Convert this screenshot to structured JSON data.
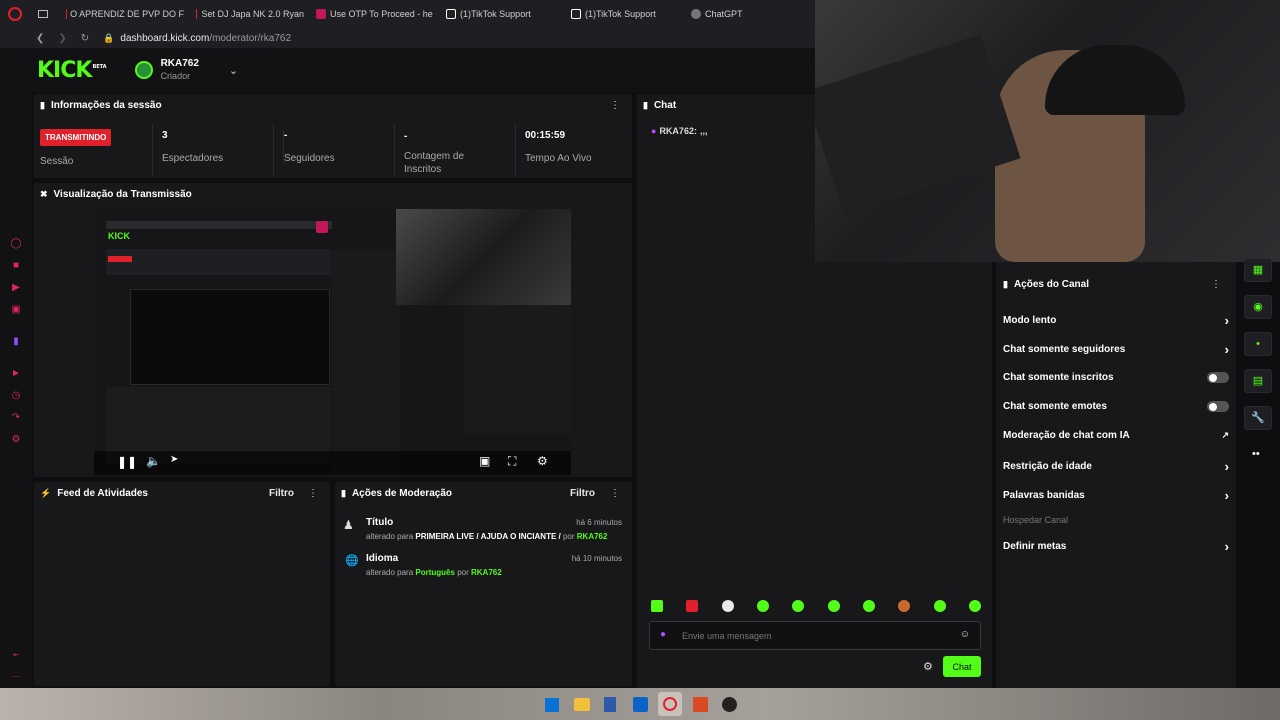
{
  "browser": {
    "tabs": [
      {
        "label": "O APRENDIZ DE PVP DO F",
        "color": "#e0202a"
      },
      {
        "label": "Set DJ Japa NK 2.0 Ryan",
        "color": "#e0202a"
      },
      {
        "label": "Use OTP To Proceed - he",
        "color": "#c2185b"
      },
      {
        "label": "(1)TikTok Support",
        "color": "#ffffff"
      },
      {
        "label": "(1)TikTok Support",
        "color": "#ffffff"
      },
      {
        "label": "ChatGPT",
        "color": "#cccccc"
      }
    ],
    "url_host": "dashboard.kick.com",
    "url_path": "/moderator/rka762"
  },
  "header": {
    "logo": "KICK",
    "logo_tag": "BETA",
    "username": "RKA762",
    "role": "Criador"
  },
  "session": {
    "title": "Informações da sessão",
    "badge": "TRANSMITINDO",
    "badge_caption": "Sessão",
    "stats": [
      {
        "value": "3",
        "label": "Espectadores"
      },
      {
        "value": "-",
        "label": "Seguidores"
      },
      {
        "value": "-",
        "label": "Contagem de Inscritos"
      },
      {
        "value": "00:15:59",
        "label": "Tempo Ao Vivo"
      }
    ]
  },
  "transmission": {
    "title": "Visualização da Transmissão"
  },
  "feed": {
    "title": "Feed de Atividades",
    "filter": "Filtro"
  },
  "moderation": {
    "title": "Ações de Moderação",
    "filter": "Filtro",
    "items": [
      {
        "title": "Título",
        "time": "há 6 minutos",
        "prefix": "alterado para",
        "value": "PRIMEIRA LIVE / AJUDA O INCIANTE /",
        "by": "por",
        "user": "RKA762"
      },
      {
        "title": "Idioma",
        "time": "há 10 minutos",
        "prefix": "alterado para",
        "value": "Português",
        "by": "por",
        "user": "RKA762"
      }
    ]
  },
  "chat": {
    "title": "Chat",
    "messages": [
      {
        "user": "RKA762:",
        "text": ",,,"
      }
    ],
    "placeholder": "Envie uma mensagem",
    "send": "Chat"
  },
  "actions": {
    "title": "Ações do Canal",
    "items": [
      {
        "label": "Modo lento",
        "control": "arrow"
      },
      {
        "label": "Chat somente seguidores",
        "control": "arrow"
      },
      {
        "label": "Chat somente inscritos",
        "control": "toggle"
      },
      {
        "label": "Chat somente emotes",
        "control": "toggle"
      },
      {
        "label": "Moderação de chat com IA",
        "control": "external"
      },
      {
        "label": "Restrição de idade",
        "control": "arrow"
      },
      {
        "label": "Palavras banidas",
        "control": "arrow"
      },
      {
        "label": "Hospedar Canal",
        "control": "none"
      },
      {
        "label": "Definir metas",
        "control": "arrow"
      }
    ]
  },
  "colors": {
    "accent": "#53fc18",
    "live": "#e0202a",
    "panel": "#18181b",
    "bg": "#0e0e10"
  }
}
